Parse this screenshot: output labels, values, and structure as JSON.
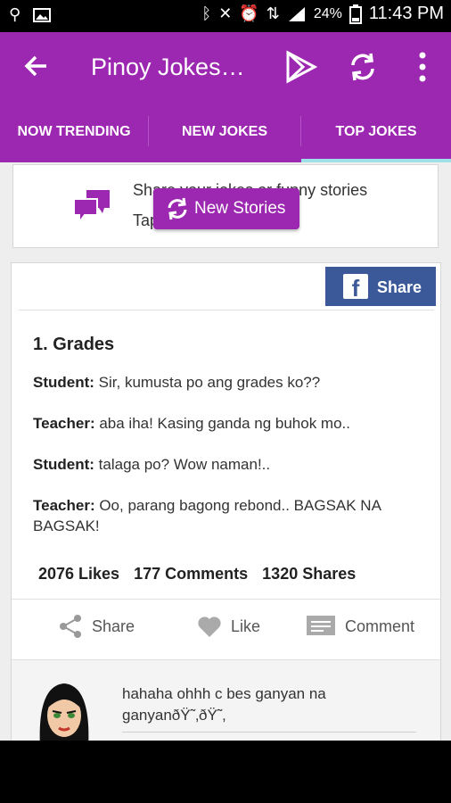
{
  "status_bar": {
    "battery": "24%",
    "time": "11:43 PM"
  },
  "app_bar": {
    "title": "Pinoy Jokes…"
  },
  "tabs": [
    {
      "label": "NOW TRENDING"
    },
    {
      "label": "NEW JOKES"
    },
    {
      "label": "TOP JOKES"
    }
  ],
  "share_card": {
    "line1": "Share your jokes or funny stories",
    "line2": "Tap"
  },
  "new_stories_button": "New Stories",
  "joke": {
    "fb_share_label": "Share",
    "title": "1. Grades",
    "lines": [
      {
        "speaker": "Student:",
        "text": " Sir, kumusta po ang grades ko??"
      },
      {
        "speaker": "Teacher:",
        "text": " aba iha! Kasing ganda ng buhok mo.."
      },
      {
        "speaker": "Student:",
        "text": " talaga po? Wow naman!.."
      },
      {
        "speaker": "Teacher:",
        "text": " Oo, parang bagong rebond.. BAGSAK NA BAGSAK!"
      }
    ],
    "likes": "2076 Likes",
    "comments": "177 Comments",
    "shares": "1320 Shares",
    "actions": {
      "share": "Share",
      "like": "Like",
      "comment": "Comment"
    }
  },
  "comment": {
    "text": "hahaha ohhh c bes ganyan na ganyanðŸ˜‚ðŸ˜‚"
  },
  "icons": {
    "back": "arrow-left-icon",
    "play": "play-store-icon",
    "refresh": "refresh-icon",
    "more": "more-vert-icon",
    "chat": "chat-bubbles-icon",
    "facebook": "facebook-icon",
    "share": "share-icon",
    "like": "heart-icon",
    "comment": "comment-icon"
  },
  "colors": {
    "primary": "#9c27b0",
    "tab_indicator": "#9ee0e8",
    "facebook": "#3b5998"
  }
}
